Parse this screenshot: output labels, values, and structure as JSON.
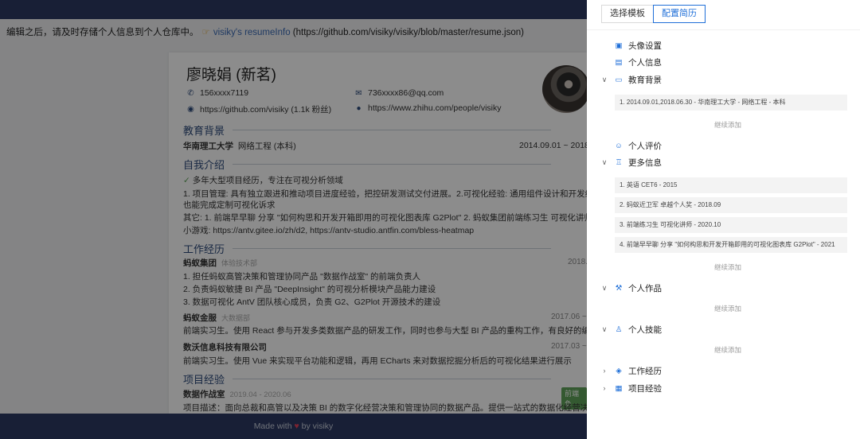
{
  "notice": {
    "text": "编辑之后，请及时存储个人信息到个人仓库中。",
    "hand_icon": "pointing-hand-icon",
    "link_text": "visiky's resumeInfo",
    "url_text": "(https://github.com/visiky/visiky/blob/master/resume.json)"
  },
  "resume": {
    "name": "廖晓娟 (新茗)",
    "phone": "156xxxx7119",
    "email": "736xxxx86@qq.com",
    "github": "https://github.com/visiky (1.1k 粉丝)",
    "zhihu": "https://www.zhihu.com/people/visiky",
    "education_title": "教育背景",
    "school": "华南理工大学",
    "major": "网络工程 (本科)",
    "edu_date": "2014.09.01 ~ 2018",
    "intro_title": "自我介绍",
    "intro_lines": [
      "多年大型项目经历，专注在可视分析领域",
      "1. 项目管理: 具有独立跟进和推动项目进度经验，把控研发测试交付进展。2.可视化经验: 通用组件设计和开发经验丰",
      "也能完成定制可视化诉求",
      "其它: 1. 前端早早聊 分享 \"如何构思和开发开箱即用的可视化图表库 G2Plot\" 2. 蚂蚁集团前端练习生 可视化讲师 3. D",
      "小游戏: https://antv.gitee.io/zh/d2, https://antv-studio.antfin.com/bless-heatmap"
    ],
    "work_title": "工作经历",
    "work": [
      {
        "company": "蚂蚁集团",
        "dept": "体验技术部",
        "date": "2018."
      },
      {
        "company": "蚂蚁金服",
        "dept": "大数据部",
        "date": "2017.06 ~ 2"
      },
      {
        "company": "数沃信息科技有限公司",
        "dept": "",
        "date": "2017.03 ~ 2"
      }
    ],
    "work_lines": [
      "1. 担任蚂蚁高管决策和管理协同产品 \"数据作战室\" 的前端负责人",
      "2. 负责蚂蚁敏捷 BI 产品 \"DeepInsight\" 的可视分析模块产品能力建设",
      "3. 数据可视化 AntV 团队核心成员，负责 G2、G2Plot 开源技术的建设"
    ],
    "work2_line": "前端实习生。使用 React 参与开发多类数据产品的研发工作，同时也参与大型 BI 产品的重构工作，有良好的编码习",
    "work3_line": "前端实习生。使用 Vue 来实现平台功能和逻辑，再用 ECharts 来对数据挖掘分析后的可视化结果进行展示",
    "project_title": "项目经验",
    "project_name": "数据作战室",
    "project_date": "2019.04 - 2020.06",
    "project_tag": "前端负",
    "project_desc": "项目描述：面向总裁和高管以及决策 BI 的数字化经营决策和管理协同的数据产品。提供一站式的数据化经营决策和"
  },
  "footer": {
    "made_with": "Made with",
    "heart_icon": "heart-icon",
    "by": "by visiky"
  },
  "drawer": {
    "tabs": [
      "选择模板",
      "配置简历"
    ],
    "sections": {
      "avatar": "头像设置",
      "profile": "个人信息",
      "education": "教育背景",
      "education_items": [
        "1. 2014.09.01,2018.06.30 - 华南理工大学 - 网络工程 - 本科"
      ],
      "add_more": "继续添加",
      "awards_self": "个人评价",
      "more": "更多信息",
      "more_items": [
        "1. 英语 CET6 - 2015",
        "2. 蚂蚁近卫军 卓越个人奖 - 2018.09",
        "3. 前端练习生 可视化讲师 - 2020.10",
        "4. 前端早早聊 分享 \"如何构思和开发开箱即用的可视化图表库 G2Plot\" - 2021"
      ],
      "works": "个人作品",
      "skills": "个人技能",
      "experience": "工作经历",
      "projects": "项目经验"
    }
  },
  "colors": {
    "accent": "#1f6fd8",
    "navy": "#2d3a63",
    "overlay": "rgba(0,0,0,0.45)"
  }
}
